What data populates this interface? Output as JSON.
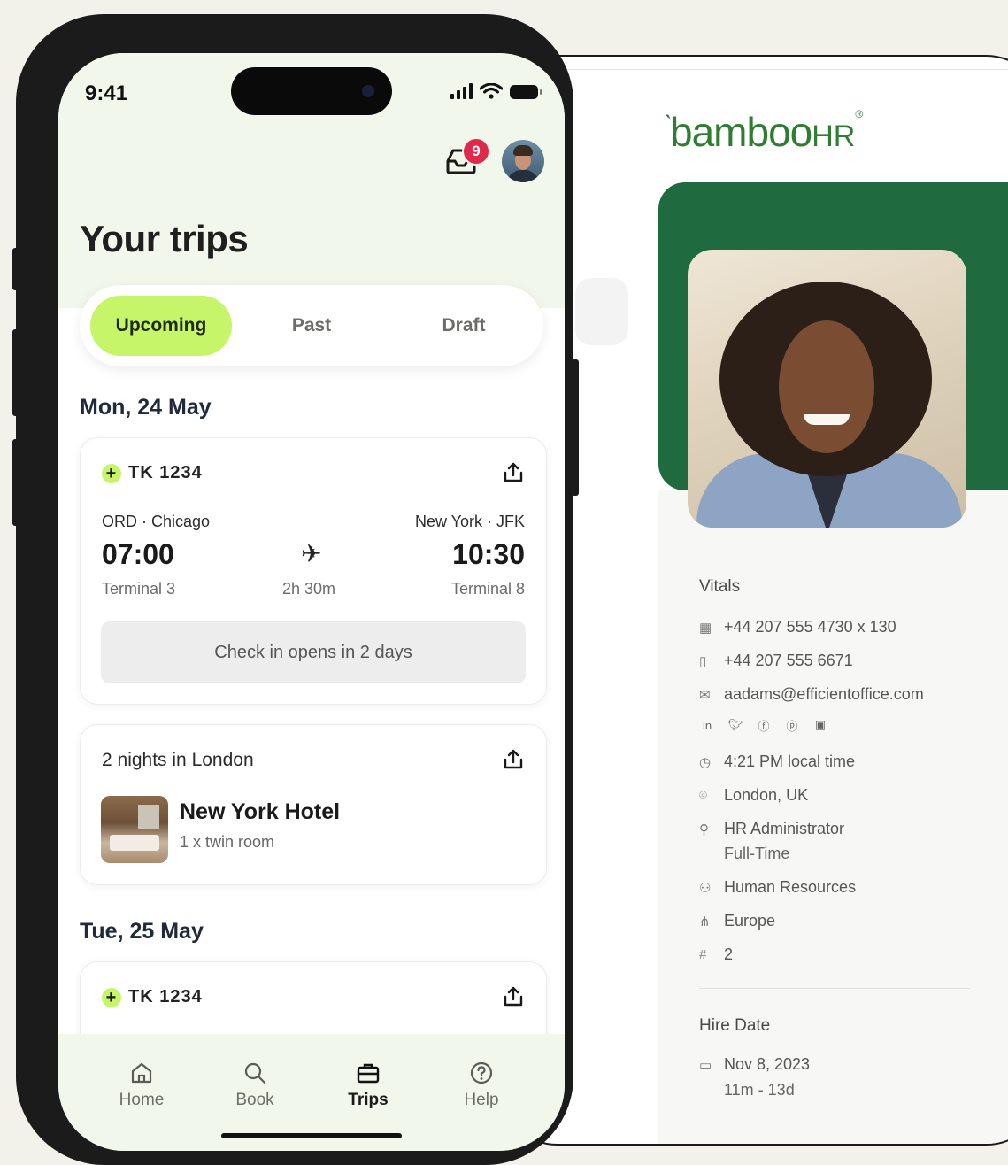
{
  "hr": {
    "logo": "bamboo",
    "logo_hr": "HR",
    "logo_reg": "®",
    "vitals_title": "Vitals",
    "phone_work": "+44 207 555 4730 x 130",
    "phone_mobile": "+44 207 555 6671",
    "email": "aadams@efficientoffice.com",
    "social_icons": [
      "linkedin-icon",
      "twitter-icon",
      "facebook-icon",
      "pinterest-icon",
      "instagram-icon"
    ],
    "local_time": "4:21 PM local time",
    "location": "London, UK",
    "job_title": "HR Administrator",
    "employment_type": "Full-Time",
    "department": "Human Resources",
    "region": "Europe",
    "hash_symbol": "#",
    "employee_number": "2",
    "hire_title": "Hire Date",
    "hire_date": "Nov 8, 2023",
    "tenure": "11m - 13d",
    "brand_color": "#2f7d32"
  },
  "phone": {
    "status_time": "9:41",
    "notifications_count": "9",
    "title": "Your trips",
    "tabs": [
      {
        "label": "Upcoming",
        "active": true
      },
      {
        "label": "Past",
        "active": false
      },
      {
        "label": "Draft",
        "active": false
      }
    ],
    "accent_color": "#c6f56a",
    "days": [
      {
        "date": "Mon, 24 May",
        "flight": {
          "code": "TK 1234",
          "plus": "+",
          "from_city": "ORD · Chicago",
          "to_city": "New York · JFK",
          "depart": "07:00",
          "arrive": "10:30",
          "duration": "2h 30m",
          "from_terminal": "Terminal 3",
          "to_terminal": "Terminal 8",
          "checkin": "Check in opens in 2 days"
        },
        "hotel": {
          "heading": "2 nights in London",
          "name": "New York Hotel",
          "room": "1 x twin room"
        }
      },
      {
        "date": "Tue, 25 May",
        "flight": {
          "code": "TK 1234",
          "plus": "+"
        }
      }
    ],
    "nav": [
      {
        "label": "Home",
        "icon": "home-icon",
        "active": false
      },
      {
        "label": "Book",
        "icon": "search-icon",
        "active": false
      },
      {
        "label": "Trips",
        "icon": "briefcase-icon",
        "active": true
      },
      {
        "label": "Help",
        "icon": "help-icon",
        "active": false
      }
    ]
  }
}
